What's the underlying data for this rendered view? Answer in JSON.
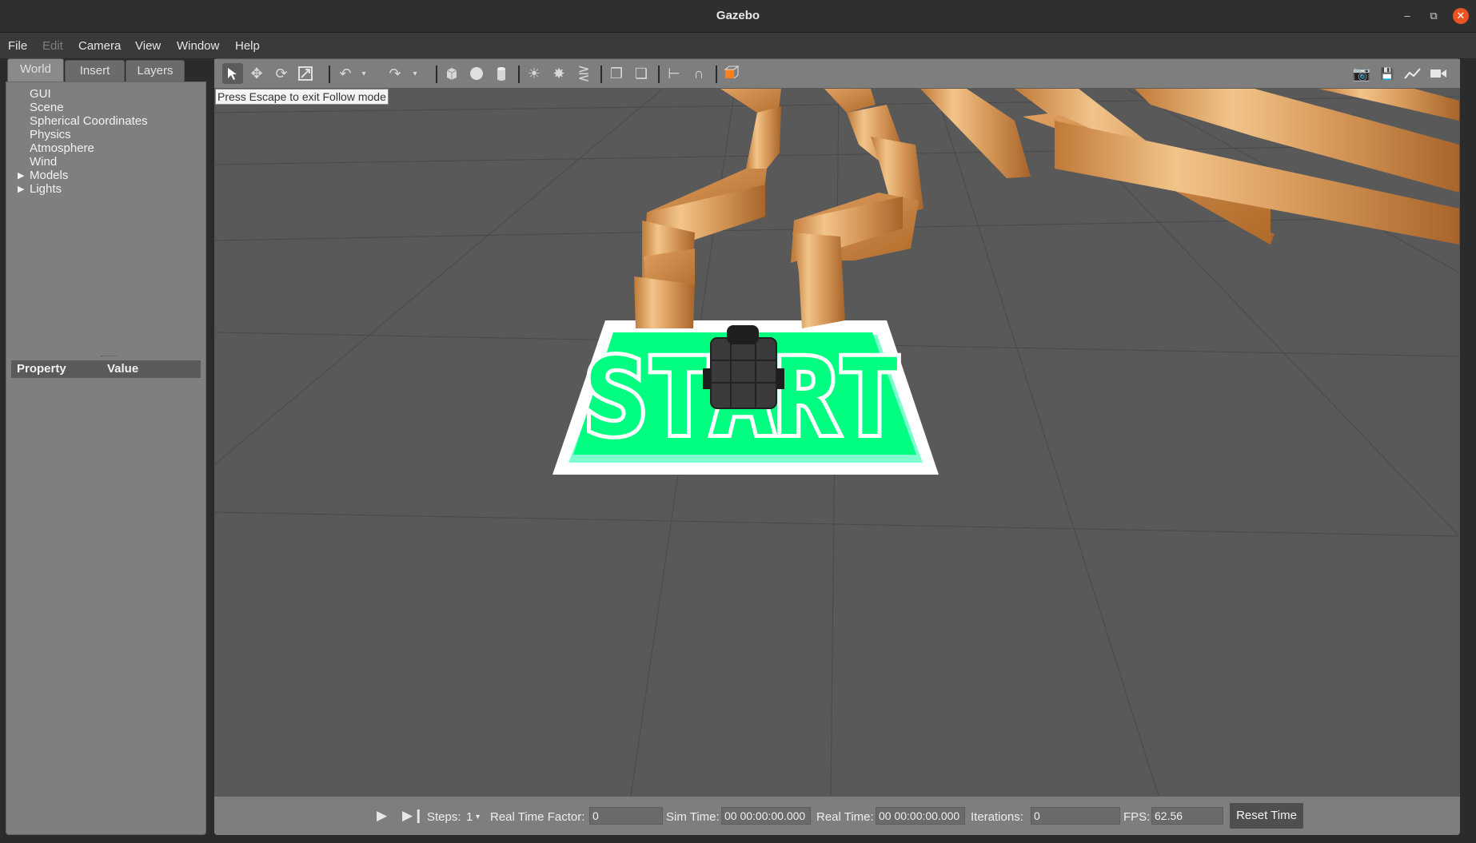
{
  "window": {
    "title": "Gazebo"
  },
  "menu": [
    {
      "label": "File",
      "enabled": true
    },
    {
      "label": "Edit",
      "enabled": false
    },
    {
      "label": "Camera",
      "enabled": true
    },
    {
      "label": "View",
      "enabled": true
    },
    {
      "label": "Window",
      "enabled": true
    },
    {
      "label": "Help",
      "enabled": true
    }
  ],
  "left_panel": {
    "tabs": [
      "World",
      "Insert",
      "Layers"
    ],
    "active_tab": "World",
    "tree": [
      {
        "label": "GUI",
        "expandable": false
      },
      {
        "label": "Scene",
        "expandable": false
      },
      {
        "label": "Spherical Coordinates",
        "expandable": false
      },
      {
        "label": "Physics",
        "expandable": false
      },
      {
        "label": "Atmosphere",
        "expandable": false
      },
      {
        "label": "Wind",
        "expandable": false
      },
      {
        "label": "Models",
        "expandable": true
      },
      {
        "label": "Lights",
        "expandable": true
      }
    ],
    "property_header": {
      "property": "Property",
      "value": "Value"
    }
  },
  "toolbar": {
    "tools": [
      "select-mode",
      "translate-mode",
      "rotate-mode",
      "scale-mode",
      "undo",
      "undo-history",
      "redo",
      "redo-history",
      "box-shape",
      "sphere-shape",
      "cylinder-shape",
      "point-light",
      "spot-light",
      "directional-light",
      "copy",
      "paste",
      "align",
      "snap",
      "change-view"
    ],
    "right_tools": [
      "screenshot",
      "log",
      "plot",
      "video-record"
    ]
  },
  "viewport": {
    "follow_hint": "Press Escape to exit Follow mode",
    "start_text": "START"
  },
  "bottom_bar": {
    "steps_label": "Steps:",
    "steps_value": "1",
    "real_time_factor_label": "Real Time Factor:",
    "real_time_factor_value": "0",
    "sim_time_label": "Sim Time:",
    "sim_time_value": "00 00:00:00.000",
    "real_time_label": "Real Time:",
    "real_time_value": "00 00:00:00.000",
    "iterations_label": "Iterations:",
    "iterations_value": "0",
    "fps_label": "FPS:",
    "fps_value": "62.56",
    "reset_time_label": "Reset Time"
  },
  "colors": {
    "start_green": "#00ff80",
    "wall_wood": "#d08a45",
    "ground": "#595959",
    "close_button": "#e95420"
  }
}
